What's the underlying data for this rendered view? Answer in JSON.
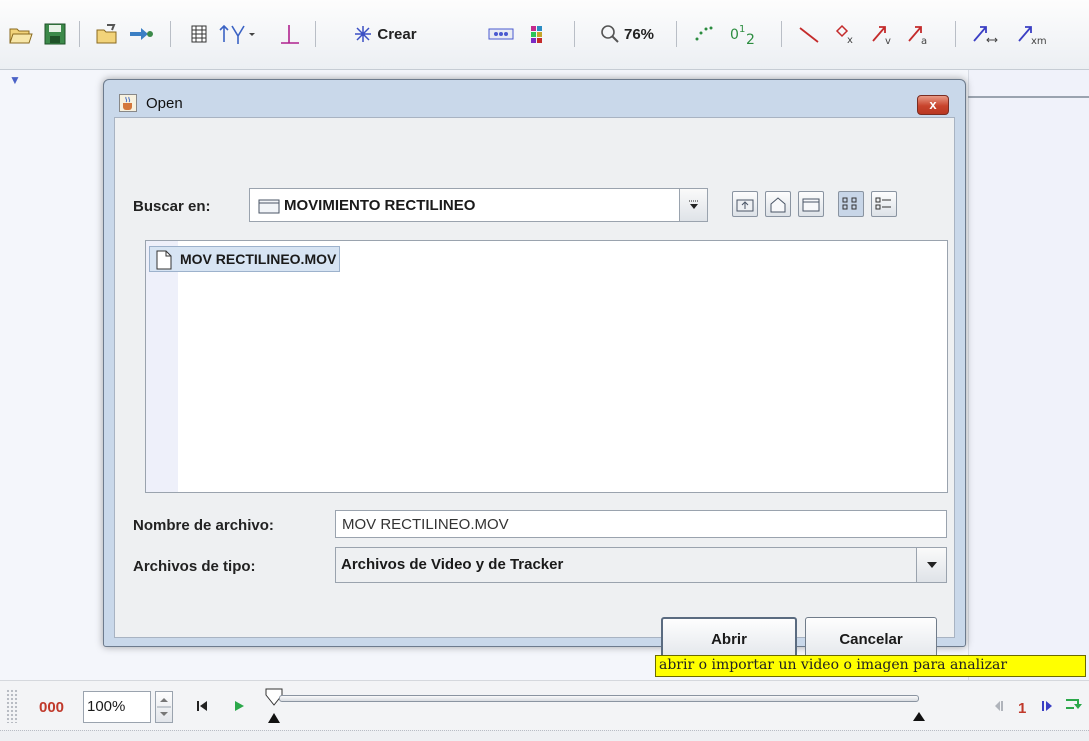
{
  "toolbar": {
    "crear_label": "Crear",
    "zoom_label": "76%"
  },
  "dialog": {
    "title": "Open",
    "close_symbol": "x",
    "look_in_label": "Buscar en:",
    "look_in_value": "MOVIMIENTO RECTILINEO",
    "files": [
      {
        "name": "MOV RECTILINEO.MOV",
        "selected": true
      }
    ],
    "filename_label": "Nombre de archivo:",
    "filename_value": "MOV RECTILINEO.MOV",
    "filetype_label": "Archivos de tipo:",
    "filetype_value": "Archivos de Video y de Tracker",
    "open_button": "Abrir",
    "cancel_button": "Cancelar"
  },
  "status_tooltip": "abrir o importar un video o imagen para analizar",
  "player": {
    "frame_number": "000",
    "zoom_value": "100%",
    "step_size": "1"
  }
}
